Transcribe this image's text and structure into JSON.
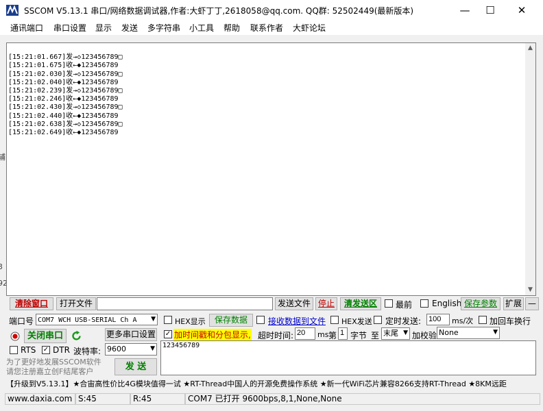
{
  "window": {
    "title": "SSCOM V5.13.1 串口/网络数据调试器,作者:大虾丁丁,2618058@qq.com. QQ群: 52502449(最新版本)",
    "minimize": "—",
    "maximize": "☐",
    "close": "✕"
  },
  "menu": [
    "通讯端口",
    "串口设置",
    "显示",
    "发送",
    "多字符串",
    "小工具",
    "帮助",
    "联系作者",
    "大虾论坛"
  ],
  "left_strip": [
    "辅",
    "3",
    "92"
  ],
  "receive": {
    "lines": [
      "[15:21:01.667]发→◇123456789□",
      "[15:21:01.675]收←◆123456789",
      "[15:21:02.030]发→◇123456789□",
      "[15:21:02.040]收←◆123456789",
      "[15:21:02.239]发→◇123456789□",
      "[15:21:02.246]收←◆123456789",
      "[15:21:02.430]发→◇123456789□",
      "[15:21:02.440]收←◆123456789",
      "[15:21:02.638]发→◇123456789□",
      "[15:21:02.649]收←◆123456789"
    ]
  },
  "toolbar": {
    "clear_window": "清除窗口",
    "open_file": "打开文件",
    "file_path": "",
    "send_file": "发送文件",
    "stop": "停止",
    "clear_send": "清发送区",
    "last": "最前",
    "english": "English",
    "save_params": "保存参数",
    "expand": "扩展",
    "collapse": "—"
  },
  "settings": {
    "port_label": "端口号",
    "port_value": "COM7 WCH USB-SERIAL Ch A",
    "hex_display": "HEX显示",
    "save_data": "保存数据",
    "recv_to_file": "接收数据到文件",
    "hex_send": "HEX发送",
    "timed_send": "定时发送:",
    "interval": "100",
    "interval_unit": "ms/次",
    "add_crlf": "加回车换行",
    "close_port": "关闭串口",
    "more_settings": "更多串口设置",
    "timestamp": "加时间戳和分包显示,",
    "timeout_label": "超时时间:",
    "timeout": "20",
    "ms": "ms",
    "nth": "第",
    "byte_index": "1",
    "byte": "字节",
    "to": "至",
    "tail": "末尾",
    "checksum_label": "加校验",
    "checksum": "None",
    "rts": "RTS",
    "dtr": "DTR",
    "baud_label": "波特率:",
    "baud": "9600",
    "send_text": "123456789",
    "send_button": "发  送",
    "promo": "为了更好地发展SSCOM软件\n请您注册嘉立创F结尾客户"
  },
  "ticker": "【升级到V5.13.1】★合宙高性价比4G模块值得一试 ★RT-Thread中国人的开源免费操作系统 ★新一代WiFi芯片兼容8266支持RT-Thread ★8KM远距",
  "status": {
    "website": "www.daxia.com",
    "sent": "S:45",
    "received": "R:45",
    "port_status": "COM7 已打开  9600bps,8,1,None,None"
  },
  "colors": {
    "red_text": "#c00000",
    "green_text": "#008000",
    "blue_text": "#0000cc",
    "highlight": "#ffff00"
  }
}
